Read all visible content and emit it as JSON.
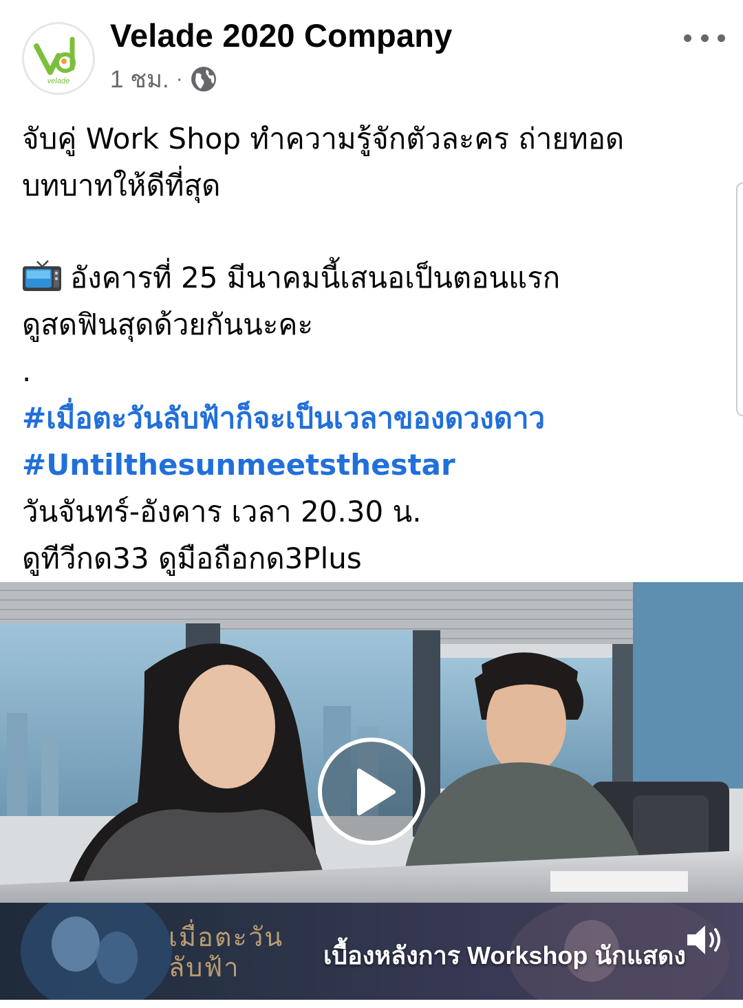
{
  "post": {
    "page_name": "Velade 2020 Company",
    "avatar_text": "velade",
    "time": "1 ชม.",
    "separator": "·",
    "privacy_icon": "globe-icon",
    "more_icon": "more-horizontal-icon",
    "body": {
      "line1": "จับคู่ Work Shop ทำความรู้จักตัวละคร ถ่ายทอด",
      "line2": "บทบาทให้ดีที่สุด",
      "emoji": "tv-icon",
      "line3": "อังคารที่ 25 มีนาคมนี้เสนอเป็นตอนแรก",
      "line4": "ดูสดฟินสุดด้วยกันนะคะ",
      "line5": ".",
      "hashtag1": "#เมื่อตะวันลับฟ้าก็จะเป็นเวลาของดวงดาว",
      "hashtag2": "#Untilthesunmeetsthestar",
      "line6": "วันจันทร์-อังคาร เวลา 20.30 น.",
      "line7": "ดูทีวีกด33 ดูมือถือกด3Plus"
    },
    "video": {
      "play_icon": "play-icon",
      "banner_logo": "เมื่อตะวัน\nลับฟ้า",
      "banner_caption": "เบื้องหลังการ Workshop นักแสดง",
      "volume_icon": "volume-icon"
    }
  },
  "colors": {
    "hashtag": "#216fdb",
    "text": "#050505",
    "meta": "#65676b"
  }
}
